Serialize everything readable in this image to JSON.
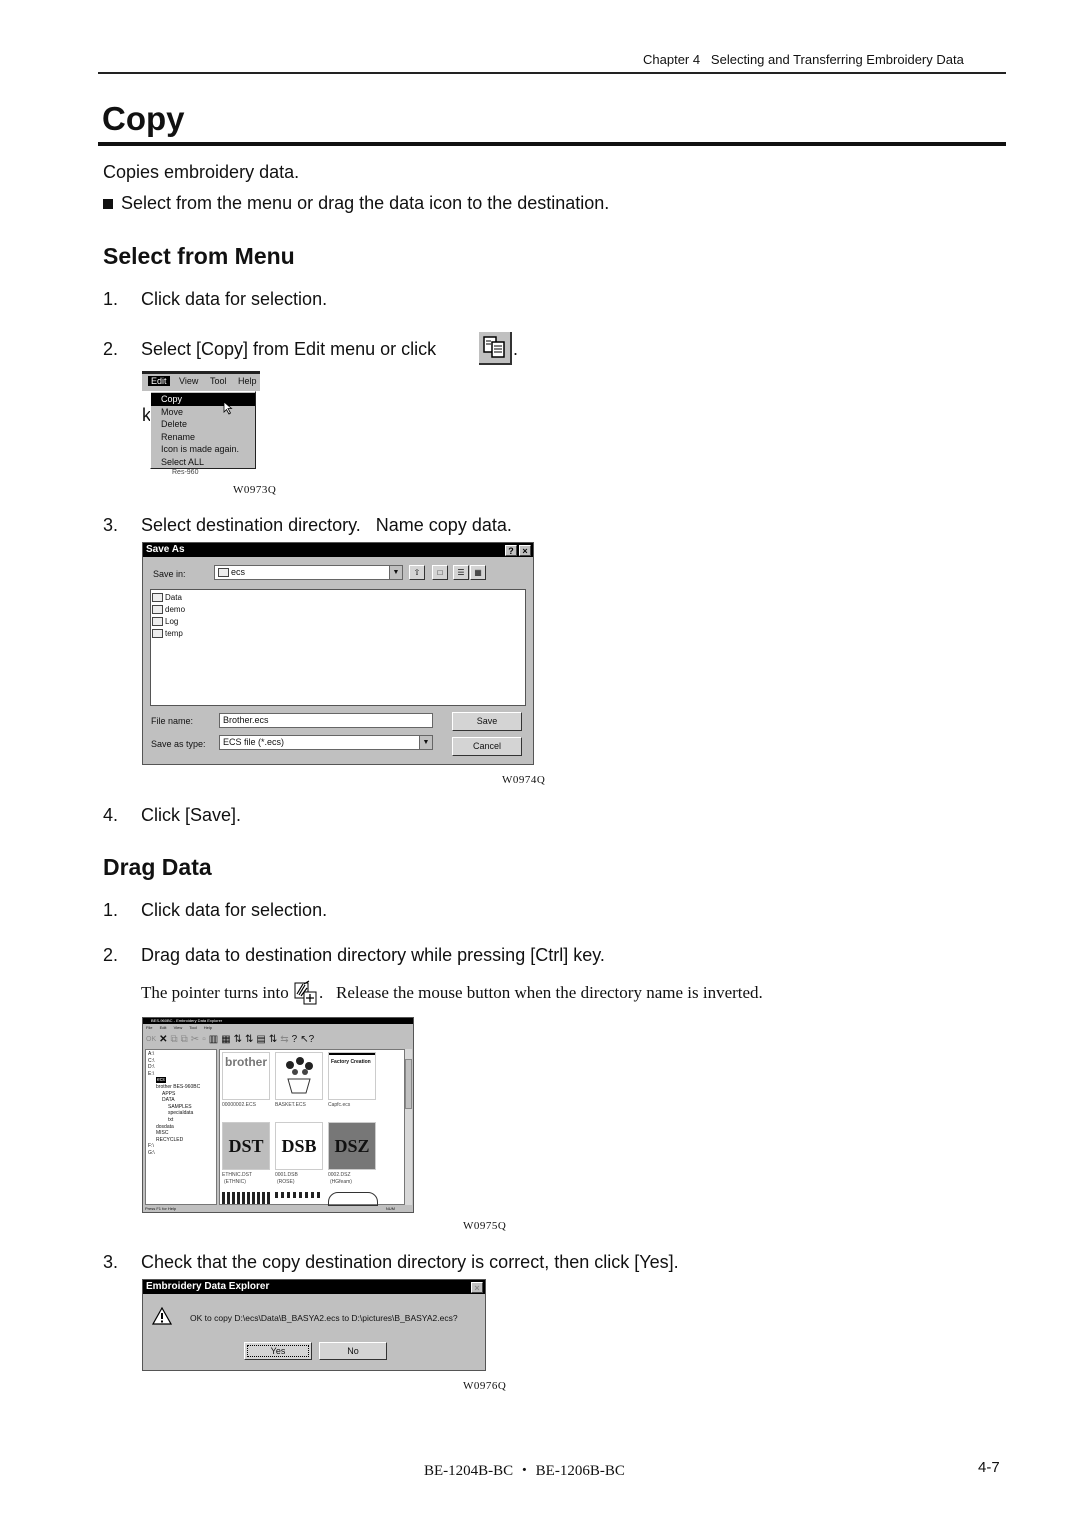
{
  "header": {
    "chapter": "Chapter 4   Selecting and Transferring Embroidery Data"
  },
  "title": "Copy",
  "intro": {
    "description": "Copies embroidery data.",
    "bullet": "Select from the menu or drag the data icon to the destination."
  },
  "select_from_menu": {
    "heading": "Select from Menu",
    "steps": [
      {
        "num": "1.",
        "text": "Click data for selection."
      },
      {
        "num": "2.",
        "text": "Select [Copy] from Edit menu or click",
        "suffix": "."
      },
      {
        "num": "3.",
        "text": "Select destination directory.   Name copy data."
      },
      {
        "num": "4.",
        "text": "Click [Save]."
      }
    ],
    "copy_icon": "copy-icon"
  },
  "edit_menu_figure": {
    "menubar": [
      "Edit",
      "View",
      "Tool",
      "Help"
    ],
    "items": [
      "Copy",
      "Move",
      "Delete",
      "Rename",
      "Icon is made again.",
      "Select ALL"
    ],
    "selected": "Copy",
    "background_text": "Res-960",
    "caption": "W0973Q"
  },
  "save_as_dialog": {
    "title": "Save As",
    "help_btn": "?",
    "close_btn": "×",
    "save_in_label": "Save in:",
    "save_in_value": "ecs",
    "folders": [
      "Data",
      "demo",
      "Log",
      "temp"
    ],
    "file_name_label": "File name:",
    "file_name_value": "Brother.ecs",
    "save_type_label": "Save as type:",
    "save_type_value": "ECS file (*.ecs)",
    "save_btn": "Save",
    "cancel_btn": "Cancel",
    "caption": "W0974Q"
  },
  "drag_data": {
    "heading": "Drag Data",
    "steps": [
      {
        "num": "1.",
        "text": "Click data for selection."
      },
      {
        "num": "2.",
        "text": "Drag data to destination directory while pressing [Ctrl] key."
      },
      {
        "num": "3.",
        "text": "Check that the copy destination directory is correct, then click [Yes]."
      }
    ],
    "note_before": "The pointer turns into",
    "note_after": ".   Release the mouse button when the directory name is inverted.",
    "pointer_icon": "drag-copy-pointer-icon"
  },
  "explorer_figure": {
    "title": "BES-960BC - Embroidery Data Explorer",
    "menu": [
      "File",
      "Edit",
      "View",
      "Tool",
      "Help"
    ],
    "tree": [
      "A:\\",
      "C:\\",
      "D:\\",
      "E:\\",
      "ecs",
      "brother BES-960BC",
      "APPS",
      "DATA",
      "SAMPLES",
      "specialdata",
      "txt",
      "dosdata",
      "MISC",
      "RECYCLED",
      "F:\\",
      "G:\\"
    ],
    "thumbnails": [
      {
        "label": "00000002.ECS",
        "art": "brother"
      },
      {
        "label": "BASKET.ECS",
        "art": "basket"
      },
      {
        "label": "Capfc.ecs",
        "art": "Factory Creation"
      },
      {
        "label": "ETHNIC.DST",
        "sub": "(ETHNIC)",
        "art": "DST"
      },
      {
        "label": "0001.DSB",
        "sub": "(ROSE)",
        "art": "DSB"
      },
      {
        "label": "0002.DSZ",
        "sub": "(HGfeam)",
        "art": "DSZ"
      }
    ],
    "status": "Press F1 for Help",
    "status_right": "NUM",
    "caption": "W0975Q"
  },
  "confirm_dialog": {
    "title": "Embroidery Data Explorer",
    "message": "OK to copy D:\\ecs\\Data\\B_BASYA2.ecs to D:\\pictures\\B_BASYA2.ecs?",
    "yes_btn": "Yes",
    "no_btn": "No",
    "caption": "W0976Q"
  },
  "footer": {
    "model": "BE-1204B-BC ・ BE-1206B-BC",
    "page": "4-7"
  }
}
